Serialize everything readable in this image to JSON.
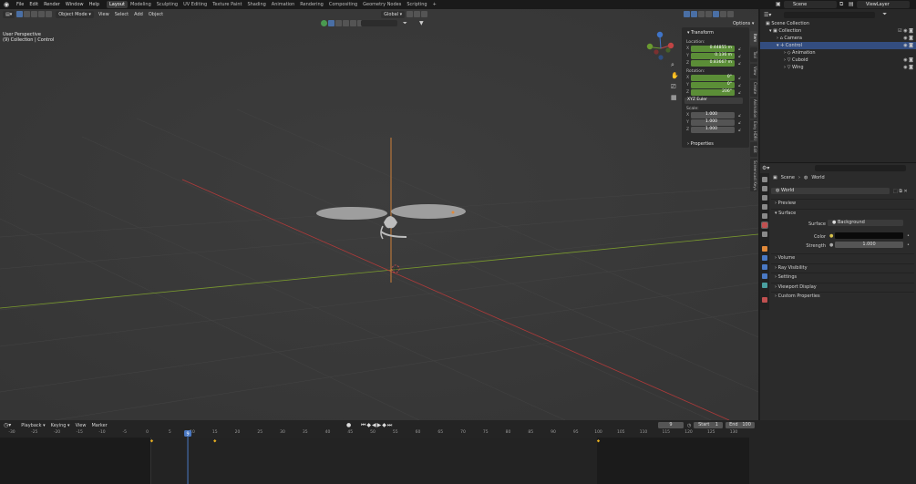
{
  "topbar": {
    "menus": [
      "File",
      "Edit",
      "Render",
      "Window",
      "Help"
    ],
    "workspaces": [
      "Layout",
      "Modeling",
      "Sculpting",
      "UV Editing",
      "Texture Paint",
      "Shading",
      "Animation",
      "Rendering",
      "Compositing",
      "Geometry Nodes",
      "Scripting"
    ],
    "active_workspace": "Layout",
    "add_tab": "+",
    "scene": "Scene",
    "view_layer": "ViewLayer"
  },
  "viewport": {
    "mode": "Object Mode",
    "menus": [
      "View",
      "Select",
      "Add",
      "Object"
    ],
    "orientation": "Global",
    "options_label": "Options",
    "view_name": "User Perspective",
    "collection_info": "(9) Collection | Control"
  },
  "n_panel": {
    "transform_header": "Transform",
    "location_label": "Location:",
    "location": [
      {
        "axis": "X",
        "value": "0.44855 m"
      },
      {
        "axis": "Y",
        "value": "0.136 m"
      },
      {
        "axis": "Z",
        "value": "0.83667 m"
      }
    ],
    "rotation_label": "Rotation:",
    "rotation": [
      {
        "axis": "X",
        "value": "0°"
      },
      {
        "axis": "Y",
        "value": "0°"
      },
      {
        "axis": "Z",
        "value": "206°"
      }
    ],
    "rotation_mode": "XYZ Euler",
    "scale_label": "Scale:",
    "scale": [
      {
        "axis": "X",
        "value": "1.000"
      },
      {
        "axis": "Y",
        "value": "1.000"
      },
      {
        "axis": "Z",
        "value": "1.000"
      }
    ],
    "properties_header": "Properties"
  },
  "side_tabs": [
    "Item",
    "Tool",
    "View",
    "Create",
    "Animation",
    "Easy HDRI",
    "Edit",
    "Screencast Keys"
  ],
  "outliner": {
    "rows": [
      {
        "label": "Scene Collection",
        "indent": 0
      },
      {
        "label": "Collection",
        "indent": 1
      },
      {
        "label": "Camera",
        "indent": 2
      },
      {
        "label": "Control",
        "indent": 2
      },
      {
        "label": "Animation",
        "indent": 3
      },
      {
        "label": "Cuboid",
        "indent": 3
      },
      {
        "label": "Wing",
        "indent": 3
      }
    ],
    "selected": "Control"
  },
  "properties": {
    "breadcrumb": [
      "Scene",
      "World"
    ],
    "world_name": "World",
    "sections": [
      "Preview",
      "Surface"
    ],
    "surface_label": "Surface",
    "surface_value": "Background",
    "color_label": "Color",
    "strength_label": "Strength",
    "strength_value": "1.000",
    "collapsed_sections": [
      "Volume",
      "Ray Visibility",
      "Settings",
      "Viewport Display",
      "Custom Properties"
    ]
  },
  "timeline": {
    "menus": [
      "Playback",
      "Keying",
      "View",
      "Marker"
    ],
    "current_frame": "9",
    "start_label": "Start",
    "start_value": "1",
    "end_label": "End",
    "end_value": "100",
    "ruler": [
      "-30",
      "-25",
      "-20",
      "-15",
      "-10",
      "-5",
      "0",
      "5",
      "10",
      "15",
      "20",
      "25",
      "30",
      "35",
      "40",
      "45",
      "50",
      "55",
      "60",
      "65",
      "70",
      "75",
      "80",
      "85",
      "90",
      "95",
      "100",
      "105",
      "110",
      "115",
      "120",
      "125",
      "130"
    ],
    "playhead_label": "9",
    "keyframes": [
      1,
      15,
      100
    ]
  },
  "colors": {
    "accent": "#4a79c4",
    "selection": "#334d80",
    "field_green": "#5b8e37",
    "x_axis": "#b03a3a",
    "y_axis": "#7a9a2e",
    "object_orange": "#e0893a"
  }
}
